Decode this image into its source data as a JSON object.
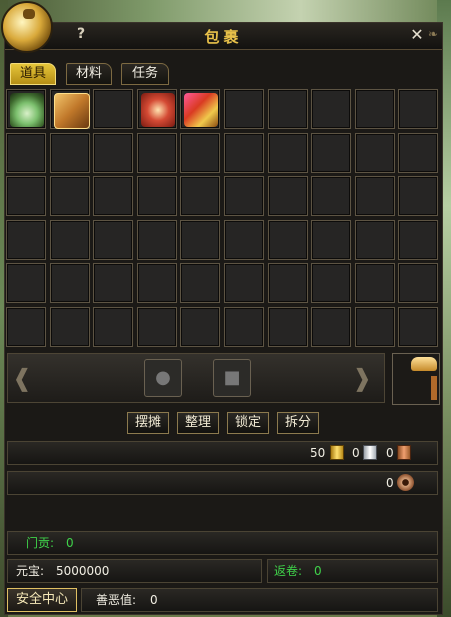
{
  "window": {
    "title": "包裹",
    "help_label": "?",
    "close_label": "✕"
  },
  "tabs": [
    {
      "label": "道具",
      "active": true
    },
    {
      "label": "材料",
      "active": false
    },
    {
      "label": "任务",
      "active": false
    }
  ],
  "inventory": {
    "columns": 10,
    "rows": 6,
    "items": [
      {
        "slot": 0,
        "icon": "cloth-bag-icon"
      },
      {
        "slot": 1,
        "icon": "treasure-chest-icon"
      },
      {
        "slot": 3,
        "icon": "gift-box-icon"
      },
      {
        "slot": 4,
        "icon": "jeweled-chest-icon"
      }
    ]
  },
  "action_slots": [
    {
      "icon": "bag-silhouette-icon"
    },
    {
      "icon": "chest-silhouette-icon"
    }
  ],
  "buttons": [
    {
      "label": "摆摊"
    },
    {
      "label": "整理"
    },
    {
      "label": "锁定"
    },
    {
      "label": "拆分"
    }
  ],
  "currency": {
    "gold": "50",
    "silver": "0",
    "copper": "0",
    "coins": "0"
  },
  "stats": {
    "contribution_label": "门贡:",
    "contribution_value": "0",
    "yuanbao_label": "元宝:",
    "yuanbao_value": "5000000",
    "return_label": "返卷:",
    "return_value": "0",
    "safety_center_label": "安全中心",
    "karma_label": "善恶值:",
    "karma_value": "0"
  },
  "colors": {
    "accent_gold": "#e8c14a",
    "stat_green": "#3fd24a",
    "panel_bg": "#1b1916"
  }
}
